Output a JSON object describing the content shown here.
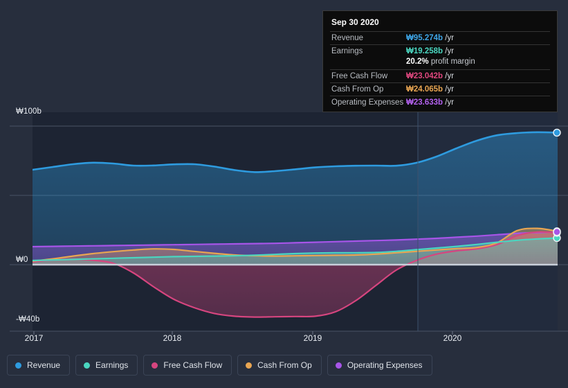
{
  "chart_data": {
    "type": "area",
    "title": "",
    "xlabel": "",
    "ylabel": "",
    "grid": true,
    "legend_position": "bottom",
    "currency_symbol": "₩",
    "x_ticks": [
      "2017",
      "2018",
      "2019",
      "2020"
    ],
    "x_tick_positions": [
      49,
      249,
      452,
      654
    ],
    "y_ticks": [
      "₩100b",
      "₩0",
      "-₩40b"
    ],
    "y_tick_values": [
      100,
      0,
      -40
    ],
    "ylim": [
      -48,
      110
    ],
    "gridlines": [
      100,
      50,
      0
    ],
    "series": [
      {
        "name": "Revenue",
        "color": "#2e9bdf",
        "values": [
          68.5,
          70.5,
          72.5,
          73.6,
          73.0,
          71.5,
          71.6,
          72.4,
          72.5,
          70.8,
          68.3,
          66.8,
          67.5,
          68.8,
          70.2,
          71.0,
          71.4,
          71.5,
          71.4,
          73.5,
          78.0,
          84.0,
          89.5,
          93.4,
          95.0,
          95.6,
          95.274
        ]
      },
      {
        "name": "Earnings",
        "color": "#4ad6c0",
        "values": [
          3.0,
          3.4,
          3.8,
          4.2,
          4.6,
          5.0,
          5.4,
          5.8,
          6.0,
          6.2,
          6.4,
          6.8,
          7.4,
          8.0,
          8.4,
          8.6,
          8.6,
          8.8,
          9.6,
          10.8,
          12.0,
          13.2,
          14.6,
          16.2,
          17.6,
          18.6,
          19.258
        ]
      },
      {
        "name": "Free Cash Flow",
        "color": "#d6457f",
        "values": [
          2.0,
          3.4,
          4.0,
          3.2,
          1.0,
          -6.0,
          -16.0,
          -25.0,
          -31.0,
          -35.2,
          -37.2,
          -37.8,
          -37.6,
          -37.4,
          -37.2,
          -34.0,
          -26.0,
          -15.0,
          -4.0,
          3.0,
          7.6,
          10.0,
          11.4,
          14.5,
          21.0,
          23.6,
          23.042
        ]
      },
      {
        "name": "Cash From Op",
        "color": "#e8a552",
        "values": [
          2.6,
          4.2,
          6.2,
          8.0,
          9.4,
          10.6,
          11.4,
          11.0,
          9.6,
          8.2,
          7.0,
          6.4,
          6.2,
          6.4,
          6.6,
          6.8,
          7.0,
          7.6,
          8.6,
          9.6,
          10.6,
          11.6,
          12.4,
          15.8,
          24.6,
          26.2,
          24.065
        ]
      },
      {
        "name": "Operating Expenses",
        "color": "#a755e8",
        "values": [
          13.0,
          13.2,
          13.4,
          13.6,
          13.8,
          14.0,
          14.2,
          14.4,
          14.6,
          14.8,
          15.0,
          15.2,
          15.4,
          15.8,
          16.2,
          16.6,
          17.0,
          17.4,
          17.8,
          18.4,
          19.0,
          19.8,
          20.6,
          21.6,
          22.6,
          23.2,
          23.633
        ]
      }
    ]
  },
  "tooltip": {
    "title": "Sep 30 2020",
    "rows": [
      {
        "key": "Revenue",
        "amount": "₩95.274b",
        "unit": "/yr",
        "color": "#3ea6e8"
      },
      {
        "key": "Earnings",
        "amount": "₩19.258b",
        "unit": "/yr",
        "color": "#4ad6c0"
      },
      {
        "key": "Free Cash Flow",
        "amount": "₩23.042b",
        "unit": "/yr",
        "color": "#e0477f"
      },
      {
        "key": "Cash From Op",
        "amount": "₩24.065b",
        "unit": "/yr",
        "color": "#e8a552"
      },
      {
        "key": "Operating Expenses",
        "amount": "₩23.633b",
        "unit": "/yr",
        "color": "#b462f0"
      }
    ],
    "profit_margin_value": "20.2%",
    "profit_margin_label": "profit margin"
  },
  "legend": {
    "items": [
      {
        "label": "Revenue",
        "color": "#2e9bdf"
      },
      {
        "label": "Earnings",
        "color": "#4ad6c0"
      },
      {
        "label": "Free Cash Flow",
        "color": "#d6457f"
      },
      {
        "label": "Cash From Op",
        "color": "#e8a552"
      },
      {
        "label": "Operating Expenses",
        "color": "#a755e8"
      }
    ]
  }
}
